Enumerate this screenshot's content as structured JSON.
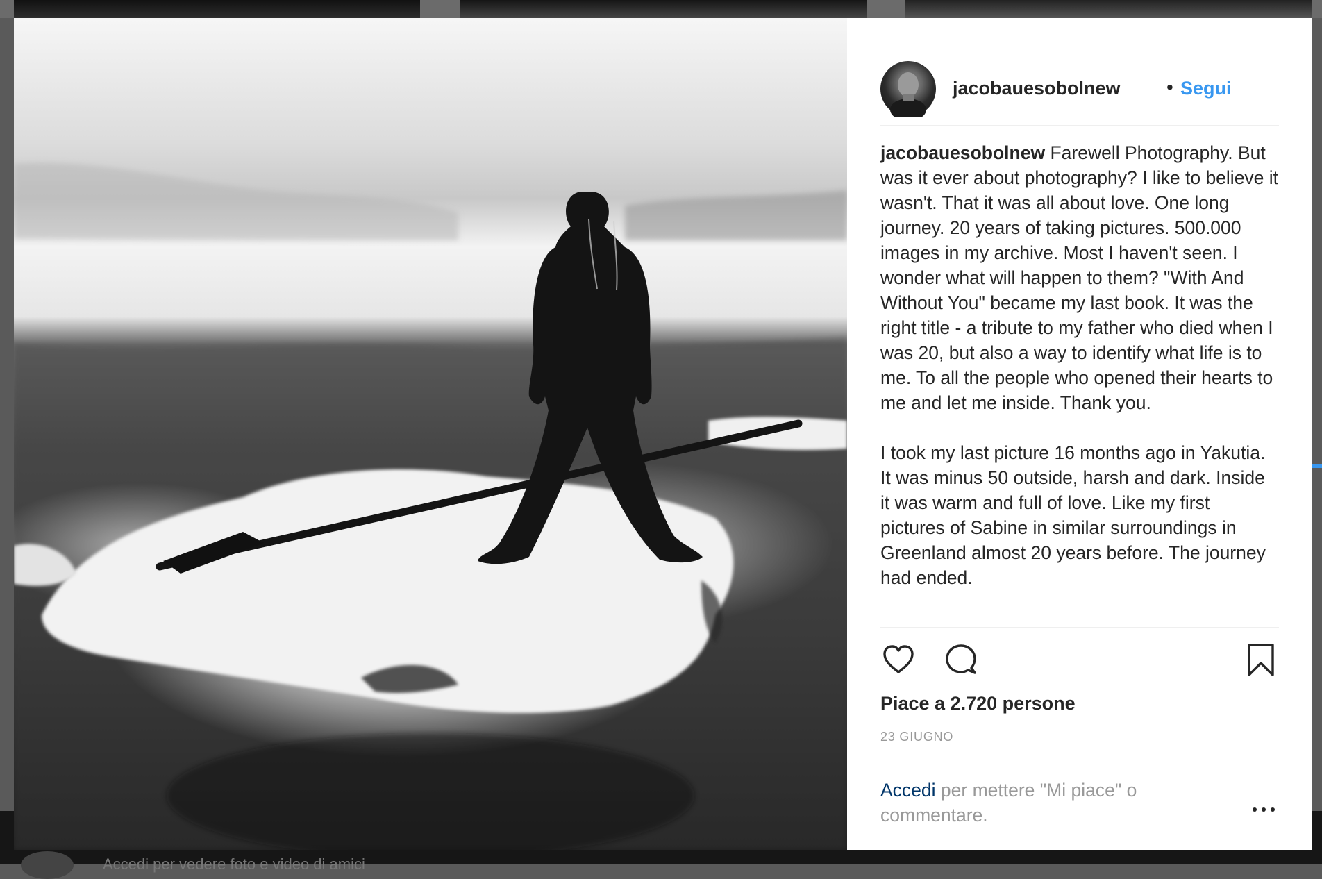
{
  "background": {
    "bottom_strip_text": "Accedi per vedere foto e video di amici"
  },
  "post": {
    "image_alt": "Black and white photo of a person standing on ice holding a harpoon",
    "header": {
      "username": "jacobauesobolnew",
      "separator": "•",
      "follow_label": "Segui"
    },
    "caption": {
      "username": "jacobauesobolnew",
      "paragraph1": "Farewell Photography. But was it ever about photography? I like to believe it wasn't. That it was all about love. One long journey. 20 years of taking pictures. 500.000 images in my archive. Most I haven't seen. I wonder what will happen to them? \"With And Without You\" became my last book. It was the right title - a tribute to my father who died when I was 20, but also a way to identify what life is to me. To all the people who opened their hearts to me and let me inside. Thank you.",
      "paragraph2": "I took my last picture 16 months ago in Yakutia. It was minus 50 outside, harsh and dark. Inside it was warm and full of love. Like my first pictures of Sabine in similar surroundings in Greenland almost 20 years before. The journey had ended."
    },
    "actions": {
      "like_icon": "heart-icon",
      "comment_icon": "speech-bubble-icon",
      "save_icon": "bookmark-icon"
    },
    "likes_text": "Piace a 2.720 persone",
    "date": "23 GIUGNO",
    "login_prompt": {
      "link_label": "Accedi",
      "text": " per mettere \"Mi piace\" o commentare."
    },
    "more_icon": "ellipsis-icon"
  },
  "colors": {
    "accent": "#3897f0",
    "link_dark": "#003569",
    "text": "#262626",
    "muted": "#999999"
  }
}
